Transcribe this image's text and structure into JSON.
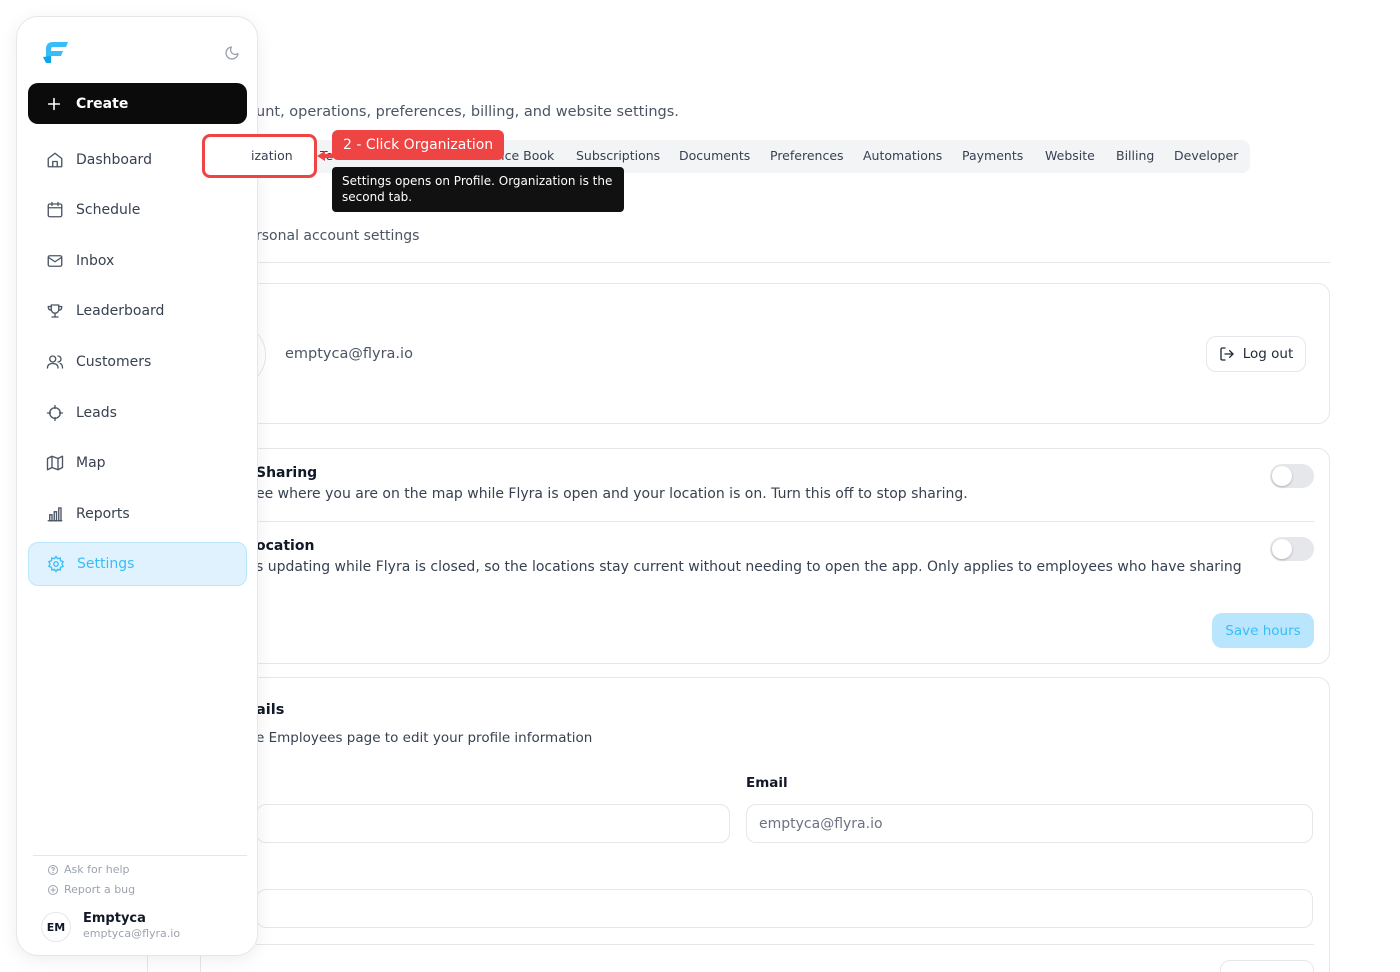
{
  "header": {
    "subtitle": "unt, operations, preferences, billing, and website settings."
  },
  "tabs": [
    {
      "label": "Te"
    },
    {
      "label": "rice Book"
    },
    {
      "label": "Subscriptions"
    },
    {
      "label": "Documents"
    },
    {
      "label": "Preferences"
    },
    {
      "label": "Automations"
    },
    {
      "label": "Payments"
    },
    {
      "label": "Website"
    },
    {
      "label": "Billing"
    },
    {
      "label": "Developer"
    }
  ],
  "profile": {
    "section_desc": "rsonal account settings",
    "email": "emptyca@flyra.io",
    "logout_label": "Log out"
  },
  "location": {
    "sharing_title": "Sharing",
    "sharing_desc": "ee where you are on the map while Flyra is open and your location is on. Turn this off to stop sharing.",
    "background_title": "ocation",
    "background_desc": "s updating while Flyra is closed, so the locations stay current without needing to open the app. Only applies to employees who have sharing",
    "save_label": "Save hours"
  },
  "details": {
    "title": "ails",
    "desc": "e Employees page to edit your profile information",
    "email_label": "Email",
    "email_value": "emptyca@flyra.io"
  },
  "sidebar": {
    "create_label": "Create",
    "items": [
      {
        "label": "Dashboard"
      },
      {
        "label": "Schedule"
      },
      {
        "label": "Inbox"
      },
      {
        "label": "Leaderboard"
      },
      {
        "label": "Customers"
      },
      {
        "label": "Leads"
      },
      {
        "label": "Map"
      },
      {
        "label": "Reports"
      },
      {
        "label": "Settings"
      }
    ],
    "help_label": "Ask for help",
    "bug_label": "Report a bug",
    "user": {
      "initials": "EM",
      "name": "Emptyca",
      "email": "emptyca@flyra.io"
    }
  },
  "tutorial": {
    "highlight_label": "ization",
    "step_label": "2 - Click Organization",
    "tooltip": "Settings opens on Profile. Organization is the second tab."
  },
  "colors": {
    "accent": "#38bdf8",
    "accent_bg": "#e0f2fe",
    "tutorial_red": "#ef4444",
    "primary_button": "#0b0b0b"
  }
}
